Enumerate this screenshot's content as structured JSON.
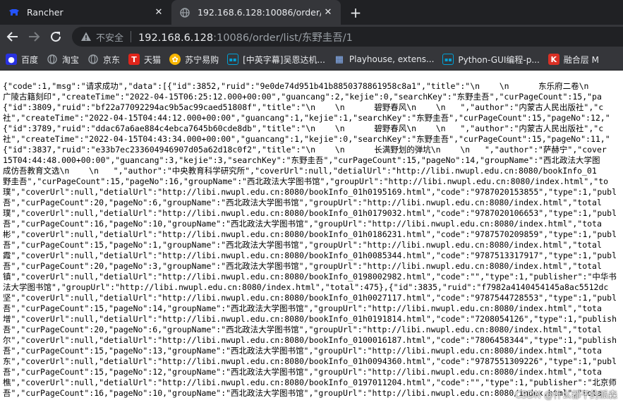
{
  "tabs": [
    {
      "title": "Rancher",
      "icon": "rancher-icon"
    },
    {
      "title": "192.168.6.128:10086/order/list",
      "icon": "globe-icon"
    }
  ],
  "omnibox": {
    "security_label": "不安全",
    "url_host": "192.168.6.128",
    "url_rest": ":10086/order/list/东野圭吾/1"
  },
  "bookmarks": [
    {
      "label": "百度",
      "icon": "paw-icon",
      "color": "#2932e1"
    },
    {
      "label": "淘宝",
      "icon": "globe-icon",
      "color": "#9aa0a6"
    },
    {
      "label": "京东",
      "icon": "globe-icon",
      "color": "#9aa0a6"
    },
    {
      "label": "天猫",
      "icon": "tmall-icon",
      "color": "#e1251b"
    },
    {
      "label": "苏宁易购",
      "icon": "lion-icon",
      "color": "#f7b500"
    },
    {
      "label": "[中英字幕]吴恩达机...",
      "icon": "bilibili-icon",
      "color": "#00a1d6"
    },
    {
      "label": "Playhouse, extens...",
      "icon": "grid-icon",
      "color": "#8ab4f8"
    },
    {
      "label": "Python-GUI编程-p...",
      "icon": "bilibili-icon",
      "color": "#00a1d6"
    },
    {
      "label": "融合层 M",
      "icon": "k-icon",
      "color": "#d93025"
    }
  ],
  "response_lines": [
    "{\"code\":1,\"msg\":\"请求成功\",\"data\":[{\"id\":3852,\"ruid\":\"9e0de74d951b41b8850378861958c8a1\",\"title\":\"\\n    \\n      东乐府二卷\\n",
    "广陵古籍刻印\",\"createTime\":\"2022-04-15T06:25:12.000+00:00\",\"guancang\":2,\"kejie\":0,\"searchKey\":\"东野圭吾\",\"curPageCount\":15,\"pa",
    "{\"id\":3809,\"ruid\":\"bf22a77092294ac9b5ac99caed51808f\",\"title\":\"\\n    \\n      碧野春风\\n    \\n   \",\"author\":\"内蒙古人民出版社\",\"c",
    "社\",\"createTime\":\"2022-04-15T04:44:12.000+00:00\",\"guancang\":1,\"kejie\":1,\"searchKey\":\"东野圭吾\",\"curPageCount\":15,\"pageNo\":12,\"",
    "{\"id\":3789,\"ruid\":\"ddac67a6ae884c4ebca7645b60cde8db\",\"title\":\"\\n    \\n      碧野春风\\n    \\n   \",\"author\":\"内蒙古人民出版社\",\"c",
    "社\",\"createTime\":\"2022-04-15T04:43:34.000+00:00\",\"guancang\":1,\"kejie\":0,\"searchKey\":\"东野圭吾\",\"curPageCount\":15,\"pageNo\":11,\"",
    "{\"id\":3837,\"ruid\":\"e33b7ec233604946907d05a62d18c0f2\",\"title\":\"\\n    \\n      长满野划的弹坑\\n    \\n   \",\"author\":\"萨赫宁\",\"cover",
    "15T04:44:48.000+00:00\",\"guancang\":3,\"kejie\":3,\"searchKey\":\"东野圭吾\",\"curPageCount\":15,\"pageNo\":14,\"groupName\":\"西北政法大学图",
    "成仿吾教育文选\\n    \\n   \",\"author\":\"中央教育科学研究所\",\"coverUrl\":null,\"detialUrl\":\"http://libi.nwupl.edu.cn:8080/bookInfo_01",
    "野圭吾\",\"curPageCount\":15,\"pageNo\":16,\"groupName\":\"西北政法大学图书馆\",\"groupUrl\":\"http://libi.nwupl.edu.cn:8080/index.html\",\"to",
    "璞\",\"coverUrl\":null,\"detialUrl\":\"http://libi.nwupl.edu.cn:8080/bookInfo_01h0195169.html\",\"code\":\"9787020153855\",\"type\":1,\"publ",
    "吾\",\"curPageCount\":20,\"pageNo\":6,\"groupName\":\"西北政法大学图书馆\",\"groupUrl\":\"http://libi.nwupl.edu.cn:8080/index.html\",\"total",
    "璞\",\"coverUrl\":null,\"detialUrl\":\"http://libi.nwupl.edu.cn:8080/bookInfo_01h0179032.html\",\"code\":\"9787020106653\",\"type\":1,\"publ",
    "吾\",\"curPageCount\":16,\"pageNo\":10,\"groupName\":\"西北政法大学图书馆\",\"groupUrl\":\"http://libi.nwupl.edu.cn:8080/index.html\",\"tota",
    "彬\",\"coverUrl\":null,\"detialUrl\":\"http://libi.nwupl.edu.cn:8080/bookInfo_01h0186231.html\",\"code\":\"9787570209859\",\"type\":1,\"publ",
    "吾\",\"curPageCount\":15,\"pageNo\":1,\"groupName\":\"西北政法大学图书馆\",\"groupUrl\":\"http://libi.nwupl.edu.cn:8080/index.html\",\"total",
    "霞\",\"coverUrl\":null,\"detialUrl\":\"http://libi.nwupl.edu.cn:8080/bookInfo_01h0085344.html\",\"code\":\"9787513317917\",\"type\":1,\"publ",
    "吾\",\"curPageCount\":20,\"pageNo\":3,\"groupName\":\"西北政法大学图书馆\",\"groupUrl\":\"http://libi.nwupl.edu.cn:8080/index.html\",\"total",
    "镇\",\"coverUrl\":null,\"detialUrl\":\"http://libi.nwupl.edu.cn:8080/bookInfo_0198002982.html\",\"code\":\"\",\"type\":1,\"publisher\":\"中华书",
    "法大学图书馆\",\"groupUrl\":\"http://libi.nwupl.edu.cn:8080/index.html\",\"total\":475},{\"id\":3835,\"ruid\":\"f7982a4140454145a8ac5512dc",
    "坚\",\"coverUrl\":null,\"detialUrl\":\"http://libi.nwupl.edu.cn:8080/bookInfo_01h0027117.html\",\"code\":\"9787544728553\",\"type\":1,\"publ",
    "吾\",\"curPageCount\":15,\"pageNo\":14,\"groupName\":\"西北政法大学图书馆\",\"groupUrl\":\"http://libi.nwupl.edu.cn:8080/index.html\",\"tota",
    "增\",\"coverUrl\":null,\"detialUrl\":\"http://libi.nwupl.edu.cn:8080/bookInfo_01h0191814.html\",\"code\":\"7208054126\",\"type\":1,\"publish",
    "吾\",\"curPageCount\":20,\"pageNo\":6,\"groupName\":\"西北政法大学图书馆\",\"groupUrl\":\"http://libi.nwupl.edu.cn:8080/index.html\",\"total",
    "尔\",\"coverUrl\":null,\"detialUrl\":\"http://libi.nwupl.edu.cn:8080/bookInfo_0100016187.html\",\"code\":\"7806458344\",\"type\":1,\"publish",
    "吾\",\"curPageCount\":15,\"pageNo\":13,\"groupName\":\"西北政法大学图书馆\",\"groupUrl\":\"http://libi.nwupl.edu.cn:8080/index.html\",\"tota",
    "东\",\"coverUrl\":null,\"detialUrl\":\"http://libi.nwupl.edu.cn:8080/bookInfo_01h0094360.html\",\"code\":\"9787551309226\",\"type\":1,\"publ",
    "吾\",\"curPageCount\":15,\"pageNo\":12,\"groupName\":\"西北政法大学图书馆\",\"groupUrl\":\"http://libi.nwupl.edu.cn:8080/index.html\",\"tota",
    "樵\",\"coverUrl\":null,\"detialUrl\":\"http://libi.nwupl.edu.cn:8080/bookInfo_0197011204.html\",\"code\":\"\",\"type\":1,\"publisher\":\"北京师",
    "吾\",\"curPageCount\":16,\"pageNo\":10,\"groupName\":\"西北政法大学图书馆\",\"groupUrl\":\"http://libi.nwupl.edu.cn:8080/index.html\",\"tota"
  ],
  "watermark": "CSDN @什么都干的派森"
}
